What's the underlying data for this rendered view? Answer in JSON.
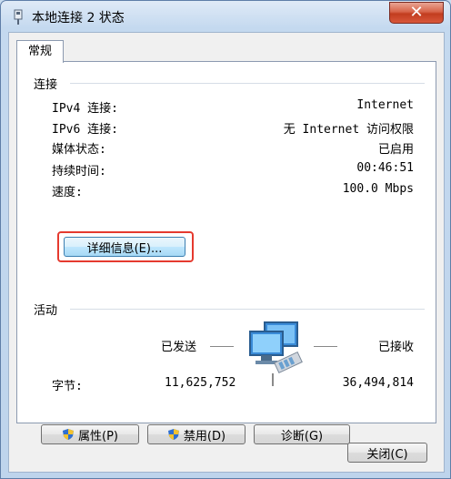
{
  "window": {
    "title": "本地连接 2 状态",
    "close_glyph": "✕"
  },
  "tabs": [
    {
      "label": "常规"
    }
  ],
  "connection": {
    "section_title": "连接",
    "rows": [
      {
        "label": "IPv4 连接:",
        "value": "Internet"
      },
      {
        "label": "IPv6 连接:",
        "value": "无 Internet 访问权限"
      },
      {
        "label": "媒体状态:",
        "value": "已启用"
      },
      {
        "label": "持续时间:",
        "value": "00:46:51"
      },
      {
        "label": "速度:",
        "value": "100.0 Mbps"
      }
    ],
    "details_button": "详细信息(E)..."
  },
  "activity": {
    "section_title": "活动",
    "sent_label": "已发送",
    "received_label": "已接收",
    "bytes_label": "字节:",
    "bytes_sent": "11,625,752",
    "bytes_received": "36,494,814",
    "icon": "network-computers-icon"
  },
  "actions": {
    "properties": "属性(P)",
    "disable": "禁用(D)",
    "diagnose": "诊断(G)"
  },
  "footer": {
    "close": "关闭(C)"
  },
  "colors": {
    "highlight_border": "#e53a2f",
    "close_button": "#c23d1f",
    "shield_blue": "#2f6fd1",
    "shield_yellow": "#f2c230"
  }
}
